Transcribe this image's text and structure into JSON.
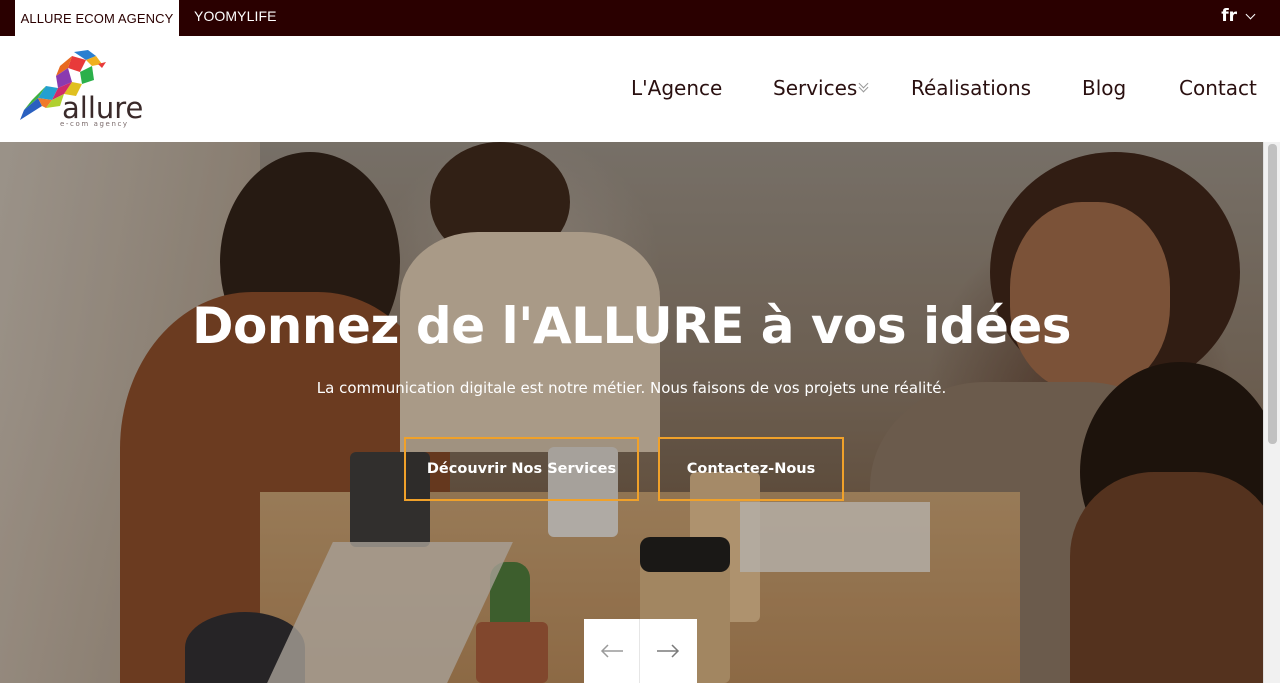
{
  "topbar": {
    "tabs": [
      {
        "label": "ALLURE ECOM AGENCY",
        "active": true
      },
      {
        "label": "YOOMYLIFE",
        "active": false
      }
    ],
    "language": {
      "code": "fr",
      "icon": "chevron-down-icon"
    }
  },
  "header": {
    "logo": {
      "word": "allure",
      "tagline": "e-com agency",
      "icon": "bird-logo-icon"
    },
    "nav": [
      {
        "label": "L'Agence"
      },
      {
        "label": "Services",
        "has_dropdown": true
      },
      {
        "label": "Réalisations"
      },
      {
        "label": "Blog"
      },
      {
        "label": "Contact"
      }
    ]
  },
  "hero": {
    "title": "Donnez de l'ALLURE à vos idées",
    "subtitle": "La communication digitale est notre métier. Nous faisons de vos projets une réalité.",
    "buttons": [
      {
        "label": "Découvrir Nos Services"
      },
      {
        "label": "Contactez-Nous"
      }
    ],
    "slider": {
      "prev_icon": "arrow-left-icon",
      "next_icon": "arrow-right-icon"
    }
  },
  "colors": {
    "topbar_bg": "#2a0000",
    "button_border": "#f0a12a",
    "text_dark": "#2a1010",
    "white": "#ffffff"
  }
}
